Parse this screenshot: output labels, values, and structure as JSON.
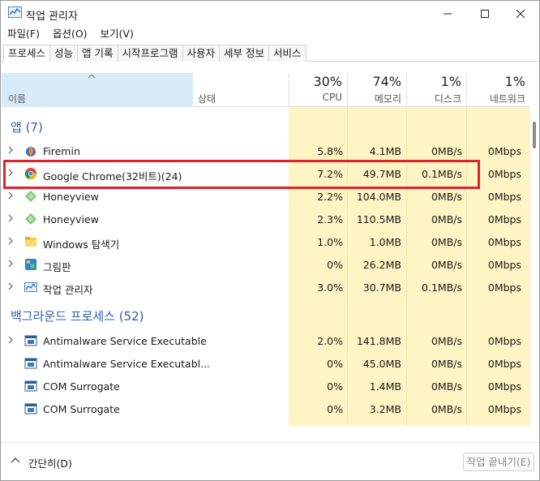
{
  "window": {
    "title": "작업 관리자"
  },
  "menu": [
    "파일(F)",
    "옵션(O)",
    "보기(V)"
  ],
  "tabs": [
    "프로세스",
    "성능",
    "앱 기록",
    "시작프로그램",
    "사용자",
    "세부 정보",
    "서비스"
  ],
  "columns": {
    "name": "이름",
    "status": "상태",
    "cpu": {
      "pct": "30%",
      "label": "CPU"
    },
    "memory": {
      "pct": "74%",
      "label": "메모리"
    },
    "disk": {
      "pct": "1%",
      "label": "디스크"
    },
    "network": {
      "pct": "1%",
      "label": "네트워크"
    }
  },
  "groups": {
    "apps": "앱 (7)",
    "background": "백그라운드 프로세스 (52)"
  },
  "rows": [
    {
      "name": "Firemin",
      "cpu": "5.8%",
      "mem": "4.1MB",
      "disk": "0MB/s",
      "net": "0Mbps",
      "icon": "firemin-icon",
      "expand": true
    },
    {
      "name": "Google Chrome(32비트)(24)",
      "cpu": "7.2%",
      "mem": "49.7MB",
      "disk": "0.1MB/s",
      "net": "0Mbps",
      "icon": "chrome-icon",
      "expand": true
    },
    {
      "name": "Honeyview",
      "cpu": "2.2%",
      "mem": "104.0MB",
      "disk": "0MB/s",
      "net": "0Mbps",
      "icon": "honeyview-icon",
      "expand": true
    },
    {
      "name": "Honeyview",
      "cpu": "2.3%",
      "mem": "110.5MB",
      "disk": "0MB/s",
      "net": "0Mbps",
      "icon": "honeyview-icon",
      "expand": true
    },
    {
      "name": "Windows 탐색기",
      "cpu": "1.0%",
      "mem": "1.0MB",
      "disk": "0MB/s",
      "net": "0Mbps",
      "icon": "folder-icon",
      "expand": true
    },
    {
      "name": "그림판",
      "cpu": "0%",
      "mem": "26.2MB",
      "disk": "0MB/s",
      "net": "0Mbps",
      "icon": "paint-icon",
      "expand": true
    },
    {
      "name": "작업 관리자",
      "cpu": "3.0%",
      "mem": "30.7MB",
      "disk": "0.1MB/s",
      "net": "0Mbps",
      "icon": "taskmgr-icon",
      "expand": true
    },
    {
      "name": "Antimalware Service Executable",
      "cpu": "2.0%",
      "mem": "141.8MB",
      "disk": "0MB/s",
      "net": "0Mbps",
      "icon": "service-icon",
      "expand": true
    },
    {
      "name": "Antimalware Service Executabl...",
      "cpu": "0%",
      "mem": "45.0MB",
      "disk": "0MB/s",
      "net": "0Mbps",
      "icon": "service-icon",
      "expand": false
    },
    {
      "name": "COM Surrogate",
      "cpu": "0%",
      "mem": "1.4MB",
      "disk": "0MB/s",
      "net": "0Mbps",
      "icon": "service-icon",
      "expand": false
    },
    {
      "name": "COM Surrogate",
      "cpu": "0%",
      "mem": "3.2MB",
      "disk": "0MB/s",
      "net": "0Mbps",
      "icon": "service-icon",
      "expand": false
    }
  ],
  "footer": {
    "simple": "간단히(D)",
    "end_task": "작업 끝내기(E)"
  },
  "colors": {
    "accent": "#2a62b0",
    "tint": "#fff4c4",
    "highlight": "#e3212a",
    "name_header": "#d9ebf9"
  }
}
